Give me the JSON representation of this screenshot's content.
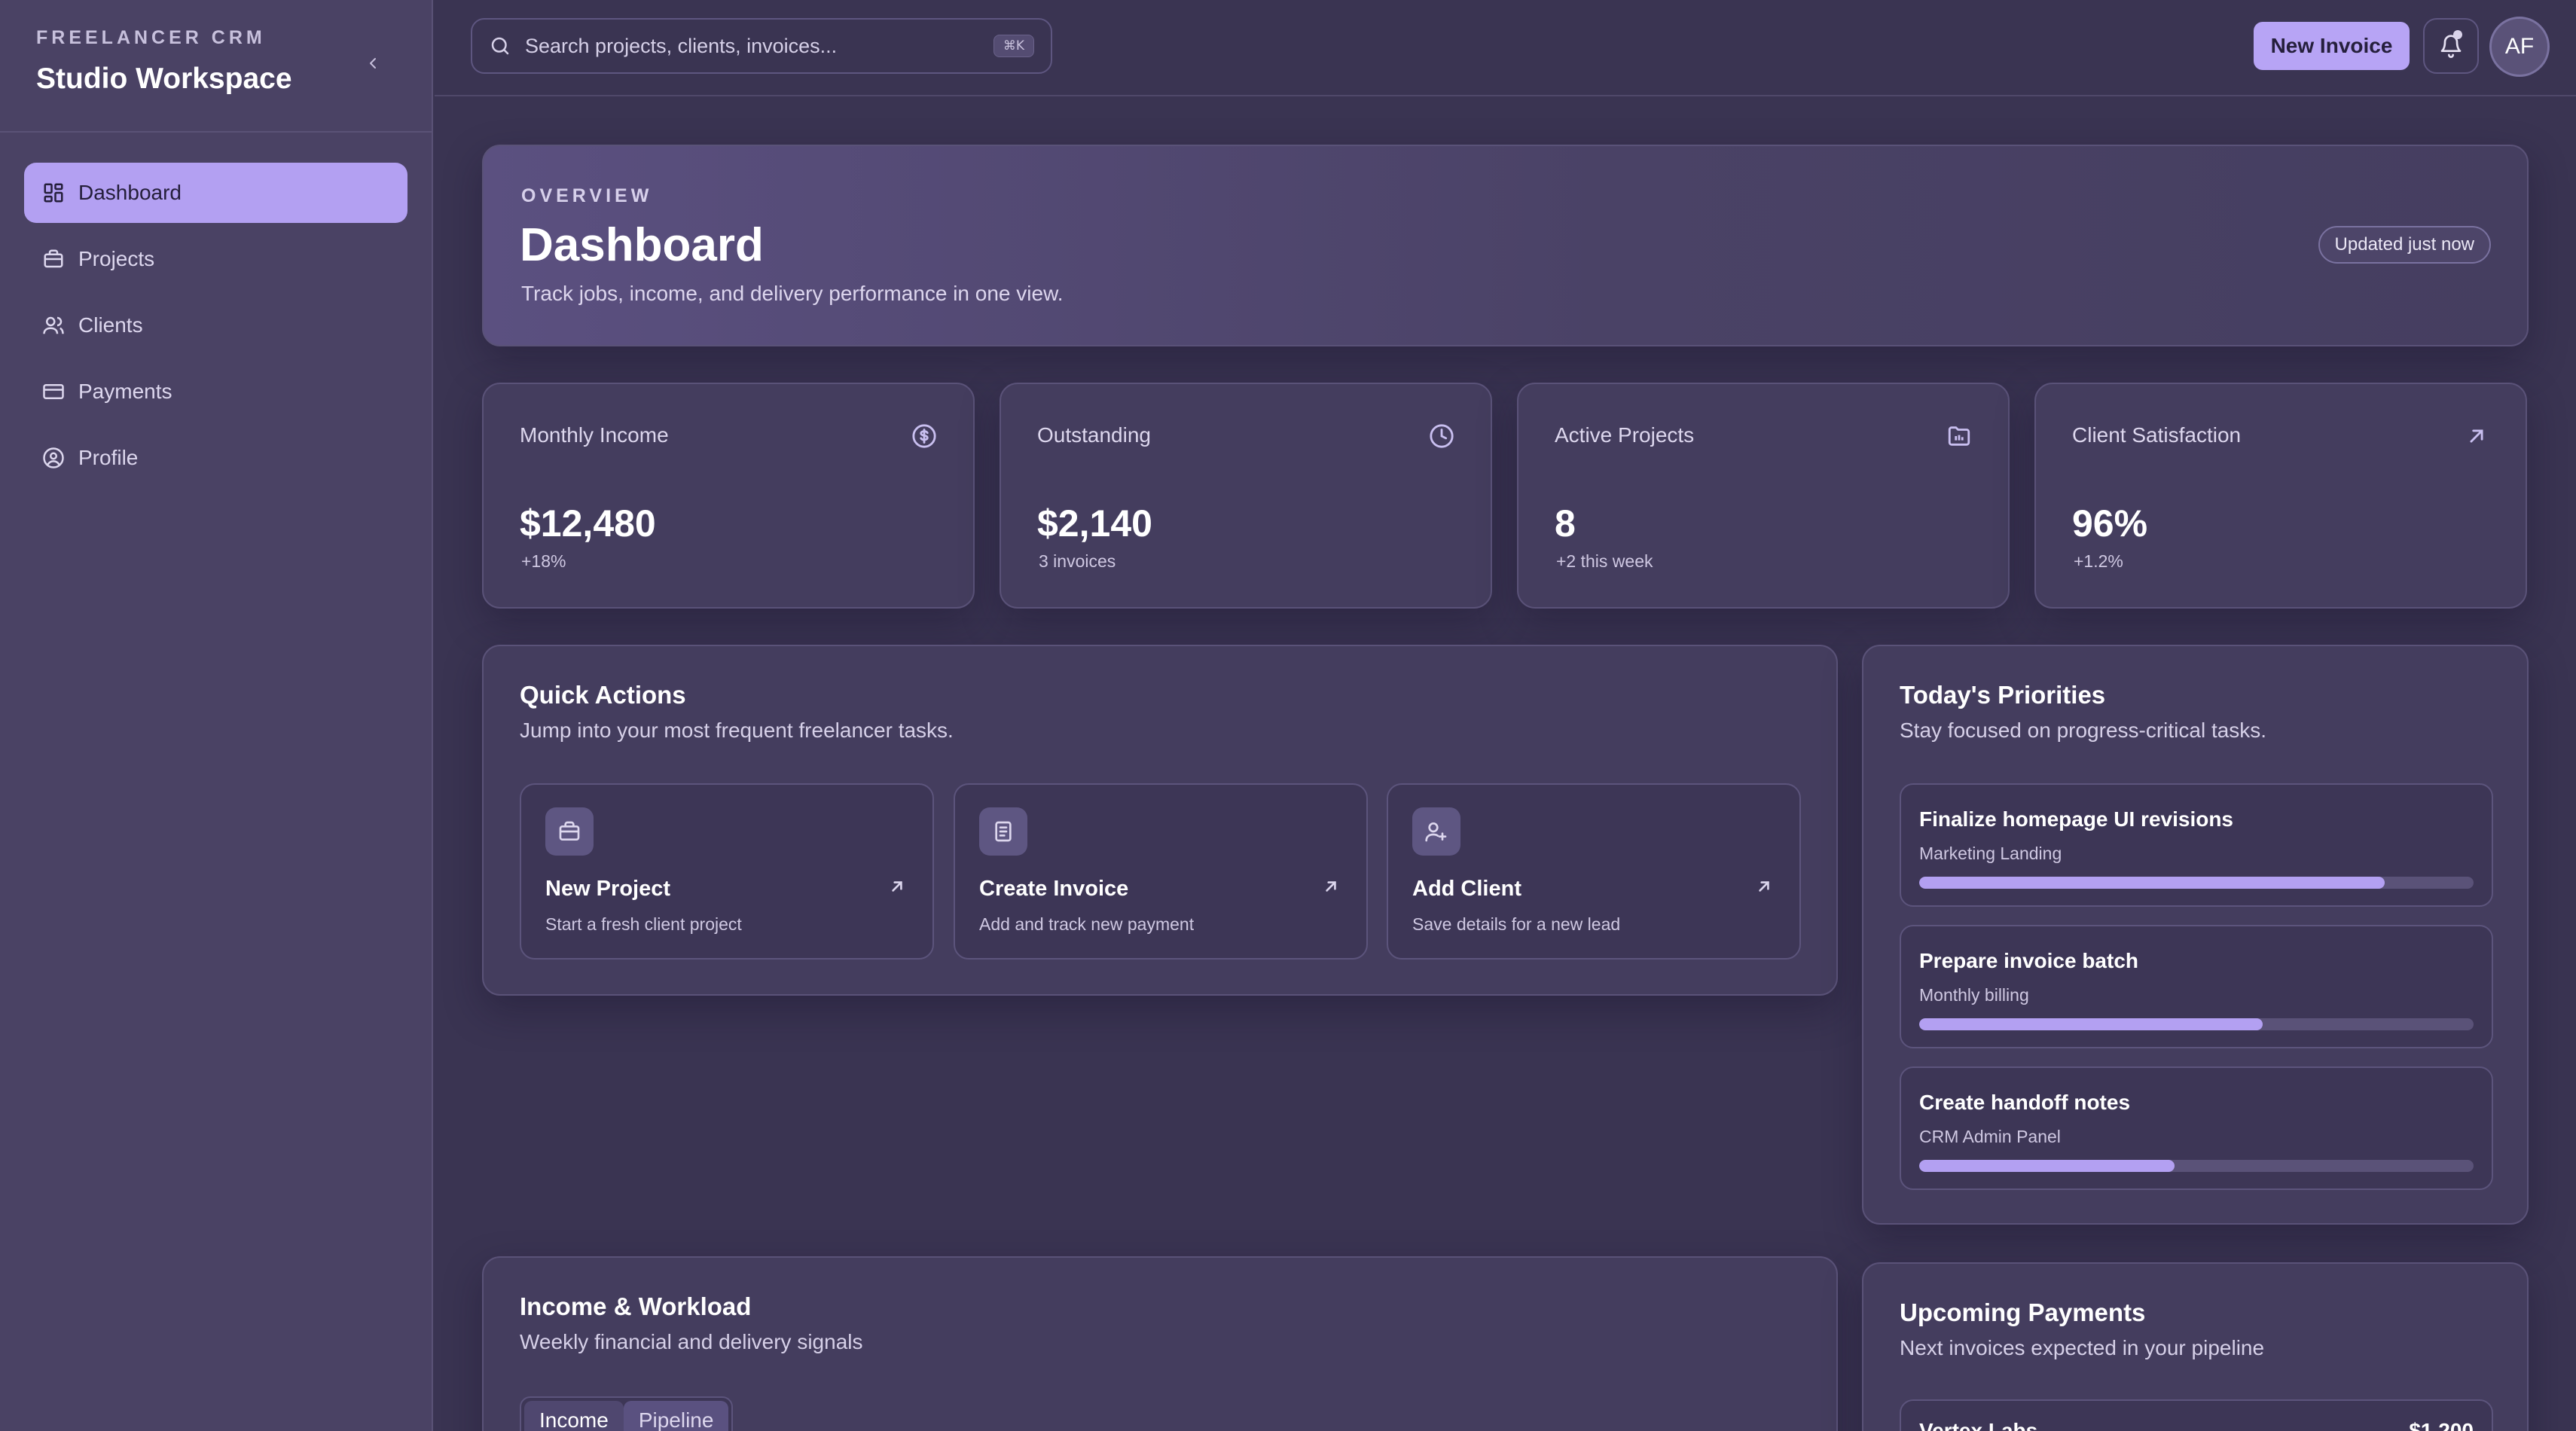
{
  "sidebar": {
    "kicker": "FREELANCER CRM",
    "title": "Studio Workspace",
    "items": [
      {
        "label": "Dashboard",
        "icon": "dashboard-icon",
        "active": true
      },
      {
        "label": "Projects",
        "icon": "briefcase-icon"
      },
      {
        "label": "Clients",
        "icon": "users-icon"
      },
      {
        "label": "Payments",
        "icon": "credit-card-icon"
      },
      {
        "label": "Profile",
        "icon": "user-circle-icon"
      }
    ]
  },
  "topbar": {
    "search_placeholder": "Search projects, clients, invoices...",
    "search_shortcut": "⌘K",
    "new_invoice_label": "New Invoice",
    "avatar_initials": "AF"
  },
  "overview": {
    "kicker": "OVERVIEW",
    "title": "Dashboard",
    "subtitle": "Track jobs, income, and delivery performance in one view.",
    "badge": "Updated just now"
  },
  "stats": [
    {
      "label": "Monthly Income",
      "value": "$12,480",
      "sub": "+18%",
      "icon": "dollar-circle-icon"
    },
    {
      "label": "Outstanding",
      "value": "$2,140",
      "sub": "3 invoices",
      "icon": "clock-icon"
    },
    {
      "label": "Active Projects",
      "value": "8",
      "sub": "+2 this week",
      "icon": "folder-icon"
    },
    {
      "label": "Client Satisfaction",
      "value": "96%",
      "sub": "+1.2%",
      "icon": "arrow-up-right-icon"
    }
  ],
  "quick_actions": {
    "title": "Quick Actions",
    "subtitle": "Jump into your most frequent freelancer tasks.",
    "items": [
      {
        "title": "New Project",
        "sub": "Start a fresh client project",
        "icon": "briefcase-icon"
      },
      {
        "title": "Create Invoice",
        "sub": "Add and track new payment",
        "icon": "invoice-icon"
      },
      {
        "title": "Add Client",
        "sub": "Save details for a new lead",
        "icon": "user-plus-icon"
      }
    ]
  },
  "priorities": {
    "title": "Today's Priorities",
    "subtitle": "Stay focused on progress-critical tasks.",
    "items": [
      {
        "title": "Finalize homepage UI revisions",
        "sub": "Marketing Landing",
        "progress": 0.84
      },
      {
        "title": "Prepare invoice batch",
        "sub": "Monthly billing",
        "progress": 0.62
      },
      {
        "title": "Create handoff notes",
        "sub": "CRM Admin Panel",
        "progress": 0.46
      }
    ]
  },
  "income": {
    "title": "Income & Workload",
    "subtitle": "Weekly financial and delivery signals",
    "tabs": [
      "Income",
      "Pipeline"
    ]
  },
  "upcoming": {
    "title": "Upcoming Payments",
    "subtitle": "Next invoices expected in your pipeline",
    "first_client": "Vertex Labs",
    "first_amount": "$1,200"
  },
  "colors": {
    "accent": "#b3a0f2",
    "background": "#3a3452",
    "sidebar": "#4a4264"
  }
}
